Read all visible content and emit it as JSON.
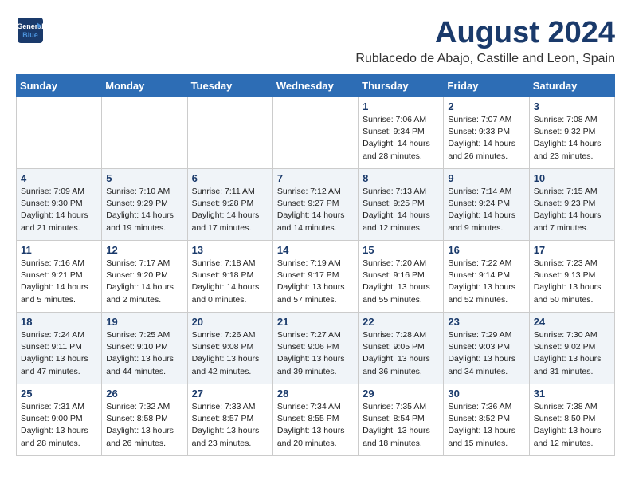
{
  "header": {
    "logo_line1": "General",
    "logo_line2": "Blue",
    "main_title": "August 2024",
    "subtitle": "Rublacedo de Abajo, Castille and Leon, Spain"
  },
  "days_of_week": [
    "Sunday",
    "Monday",
    "Tuesday",
    "Wednesday",
    "Thursday",
    "Friday",
    "Saturday"
  ],
  "weeks": [
    [
      {
        "day": "",
        "info": ""
      },
      {
        "day": "",
        "info": ""
      },
      {
        "day": "",
        "info": ""
      },
      {
        "day": "",
        "info": ""
      },
      {
        "day": "1",
        "info": "Sunrise: 7:06 AM\nSunset: 9:34 PM\nDaylight: 14 hours\nand 28 minutes."
      },
      {
        "day": "2",
        "info": "Sunrise: 7:07 AM\nSunset: 9:33 PM\nDaylight: 14 hours\nand 26 minutes."
      },
      {
        "day": "3",
        "info": "Sunrise: 7:08 AM\nSunset: 9:32 PM\nDaylight: 14 hours\nand 23 minutes."
      }
    ],
    [
      {
        "day": "4",
        "info": "Sunrise: 7:09 AM\nSunset: 9:30 PM\nDaylight: 14 hours\nand 21 minutes."
      },
      {
        "day": "5",
        "info": "Sunrise: 7:10 AM\nSunset: 9:29 PM\nDaylight: 14 hours\nand 19 minutes."
      },
      {
        "day": "6",
        "info": "Sunrise: 7:11 AM\nSunset: 9:28 PM\nDaylight: 14 hours\nand 17 minutes."
      },
      {
        "day": "7",
        "info": "Sunrise: 7:12 AM\nSunset: 9:27 PM\nDaylight: 14 hours\nand 14 minutes."
      },
      {
        "day": "8",
        "info": "Sunrise: 7:13 AM\nSunset: 9:25 PM\nDaylight: 14 hours\nand 12 minutes."
      },
      {
        "day": "9",
        "info": "Sunrise: 7:14 AM\nSunset: 9:24 PM\nDaylight: 14 hours\nand 9 minutes."
      },
      {
        "day": "10",
        "info": "Sunrise: 7:15 AM\nSunset: 9:23 PM\nDaylight: 14 hours\nand 7 minutes."
      }
    ],
    [
      {
        "day": "11",
        "info": "Sunrise: 7:16 AM\nSunset: 9:21 PM\nDaylight: 14 hours\nand 5 minutes."
      },
      {
        "day": "12",
        "info": "Sunrise: 7:17 AM\nSunset: 9:20 PM\nDaylight: 14 hours\nand 2 minutes."
      },
      {
        "day": "13",
        "info": "Sunrise: 7:18 AM\nSunset: 9:18 PM\nDaylight: 14 hours\nand 0 minutes."
      },
      {
        "day": "14",
        "info": "Sunrise: 7:19 AM\nSunset: 9:17 PM\nDaylight: 13 hours\nand 57 minutes."
      },
      {
        "day": "15",
        "info": "Sunrise: 7:20 AM\nSunset: 9:16 PM\nDaylight: 13 hours\nand 55 minutes."
      },
      {
        "day": "16",
        "info": "Sunrise: 7:22 AM\nSunset: 9:14 PM\nDaylight: 13 hours\nand 52 minutes."
      },
      {
        "day": "17",
        "info": "Sunrise: 7:23 AM\nSunset: 9:13 PM\nDaylight: 13 hours\nand 50 minutes."
      }
    ],
    [
      {
        "day": "18",
        "info": "Sunrise: 7:24 AM\nSunset: 9:11 PM\nDaylight: 13 hours\nand 47 minutes."
      },
      {
        "day": "19",
        "info": "Sunrise: 7:25 AM\nSunset: 9:10 PM\nDaylight: 13 hours\nand 44 minutes."
      },
      {
        "day": "20",
        "info": "Sunrise: 7:26 AM\nSunset: 9:08 PM\nDaylight: 13 hours\nand 42 minutes."
      },
      {
        "day": "21",
        "info": "Sunrise: 7:27 AM\nSunset: 9:06 PM\nDaylight: 13 hours\nand 39 minutes."
      },
      {
        "day": "22",
        "info": "Sunrise: 7:28 AM\nSunset: 9:05 PM\nDaylight: 13 hours\nand 36 minutes."
      },
      {
        "day": "23",
        "info": "Sunrise: 7:29 AM\nSunset: 9:03 PM\nDaylight: 13 hours\nand 34 minutes."
      },
      {
        "day": "24",
        "info": "Sunrise: 7:30 AM\nSunset: 9:02 PM\nDaylight: 13 hours\nand 31 minutes."
      }
    ],
    [
      {
        "day": "25",
        "info": "Sunrise: 7:31 AM\nSunset: 9:00 PM\nDaylight: 13 hours\nand 28 minutes."
      },
      {
        "day": "26",
        "info": "Sunrise: 7:32 AM\nSunset: 8:58 PM\nDaylight: 13 hours\nand 26 minutes."
      },
      {
        "day": "27",
        "info": "Sunrise: 7:33 AM\nSunset: 8:57 PM\nDaylight: 13 hours\nand 23 minutes."
      },
      {
        "day": "28",
        "info": "Sunrise: 7:34 AM\nSunset: 8:55 PM\nDaylight: 13 hours\nand 20 minutes."
      },
      {
        "day": "29",
        "info": "Sunrise: 7:35 AM\nSunset: 8:54 PM\nDaylight: 13 hours\nand 18 minutes."
      },
      {
        "day": "30",
        "info": "Sunrise: 7:36 AM\nSunset: 8:52 PM\nDaylight: 13 hours\nand 15 minutes."
      },
      {
        "day": "31",
        "info": "Sunrise: 7:38 AM\nSunset: 8:50 PM\nDaylight: 13 hours\nand 12 minutes."
      }
    ]
  ]
}
